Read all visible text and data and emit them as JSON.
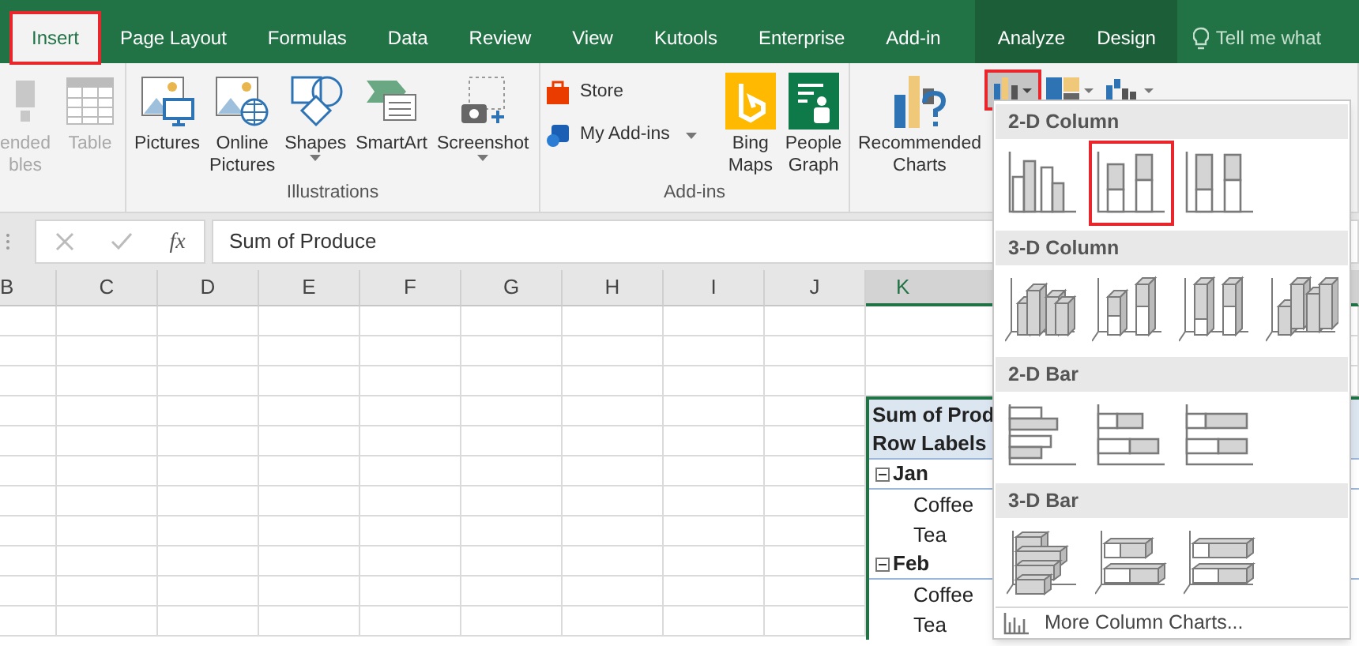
{
  "tabs": [
    {
      "label": "Insert",
      "selected": true,
      "highlighted": true
    },
    {
      "label": "Page Layout",
      "selected": false,
      "highlighted": false
    },
    {
      "label": "Formulas",
      "selected": false,
      "highlighted": false
    },
    {
      "label": "Data",
      "selected": false,
      "highlighted": false
    },
    {
      "label": "Review",
      "selected": false,
      "highlighted": false
    },
    {
      "label": "View",
      "selected": false,
      "highlighted": false
    },
    {
      "label": "Kutools",
      "selected": false,
      "highlighted": false
    },
    {
      "label": "Enterprise",
      "selected": false,
      "highlighted": false
    },
    {
      "label": "Add-in",
      "selected": false,
      "highlighted": false
    }
  ],
  "contextual_tabs": [
    {
      "label": "Analyze",
      "selected": false
    },
    {
      "label": "Design",
      "selected": false
    }
  ],
  "tell_me": "Tell me what",
  "ribbon_groups": [
    {
      "items": [
        {
          "kind": "large",
          "lines": [
            "ended",
            "bles"
          ],
          "disabled": true
        },
        {
          "kind": "large",
          "lines": [
            "Table"
          ],
          "disabled": true
        }
      ]
    },
    {
      "label": "Illustrations",
      "items": [
        {
          "kind": "large",
          "lines": [
            "Pictures"
          ],
          "disabled": false,
          "dropdown": false
        },
        {
          "kind": "large",
          "lines": [
            "Online",
            "Pictures"
          ],
          "disabled": false,
          "dropdown": false
        },
        {
          "kind": "large",
          "lines": [
            "Shapes"
          ],
          "disabled": false,
          "dropdown": true
        },
        {
          "kind": "large",
          "lines": [
            "SmartArt"
          ],
          "disabled": false,
          "dropdown": false
        },
        {
          "kind": "large",
          "lines": [
            "Screenshot"
          ],
          "disabled": false,
          "dropdown": true
        }
      ]
    },
    {
      "label": "Add-ins",
      "items": [
        {
          "kind": "small",
          "lines": [
            "Store"
          ],
          "disabled": false,
          "dropdown": false
        },
        {
          "kind": "small",
          "lines": [
            "My Add-ins"
          ],
          "disabled": false,
          "dropdown": true
        },
        {
          "kind": "large",
          "lines": [
            "Bing",
            "Maps"
          ],
          "disabled": false,
          "dropdown": false
        },
        {
          "kind": "large",
          "lines": [
            "People",
            "Graph"
          ],
          "disabled": false,
          "dropdown": false
        }
      ]
    },
    {
      "items": [
        {
          "kind": "large",
          "lines": [
            "Recommended",
            "Charts"
          ],
          "disabled": false,
          "dropdown": false
        },
        {
          "kind": "chartbutton",
          "selected": true,
          "highlighted": true
        },
        {
          "kind": "chartbutton",
          "selected": false,
          "highlighted": false
        },
        {
          "kind": "chartbutton",
          "selected": false,
          "highlighted": false
        }
      ]
    }
  ],
  "formula_bar": {
    "function_label": "fx",
    "value": "Sum of Produce"
  },
  "columns": [
    {
      "label": "B",
      "selected": false
    },
    {
      "label": "C",
      "selected": false
    },
    {
      "label": "D",
      "selected": false
    },
    {
      "label": "E",
      "selected": false
    },
    {
      "label": "F",
      "selected": false
    },
    {
      "label": "G",
      "selected": false
    },
    {
      "label": "H",
      "selected": false
    },
    {
      "label": "I",
      "selected": false
    },
    {
      "label": "J",
      "selected": false
    },
    {
      "label": "K",
      "selected": true
    }
  ],
  "pivot_table": {
    "title": "Sum of Prod",
    "header": "Row Labels",
    "rows": [
      {
        "kind": "group",
        "label": "Jan",
        "expanded": true
      },
      {
        "kind": "item",
        "label": "Coffee"
      },
      {
        "kind": "item",
        "label": "Tea"
      },
      {
        "kind": "group",
        "label": "Feb",
        "expanded": true
      },
      {
        "kind": "item",
        "label": "Coffee"
      },
      {
        "kind": "item",
        "label": "Tea"
      }
    ]
  },
  "chart_menu": {
    "sections": [
      {
        "title": "2-D Column",
        "kind": "flatcolumn",
        "options": [
          {
            "kind": "clustered",
            "highlighted": false
          },
          {
            "kind": "stacked",
            "highlighted": true
          },
          {
            "kind": "percent",
            "highlighted": false
          }
        ]
      },
      {
        "title": "3-D Column",
        "kind": "depthcolumn",
        "options": [
          {
            "kind": "clustered",
            "highlighted": false
          },
          {
            "kind": "stacked",
            "highlighted": false
          },
          {
            "kind": "percent",
            "highlighted": false
          },
          {
            "kind": "perspective",
            "highlighted": false
          }
        ]
      },
      {
        "title": "2-D Bar",
        "kind": "flatbar",
        "options": [
          {
            "kind": "clustered",
            "highlighted": false
          },
          {
            "kind": "stacked",
            "highlighted": false
          },
          {
            "kind": "percent",
            "highlighted": false
          }
        ]
      },
      {
        "title": "3-D Bar",
        "kind": "depthbar",
        "options": [
          {
            "kind": "clustered",
            "highlighted": false
          },
          {
            "kind": "stacked",
            "highlighted": false
          },
          {
            "kind": "percent",
            "highlighted": false
          }
        ]
      }
    ],
    "more": "More Column Charts..."
  }
}
